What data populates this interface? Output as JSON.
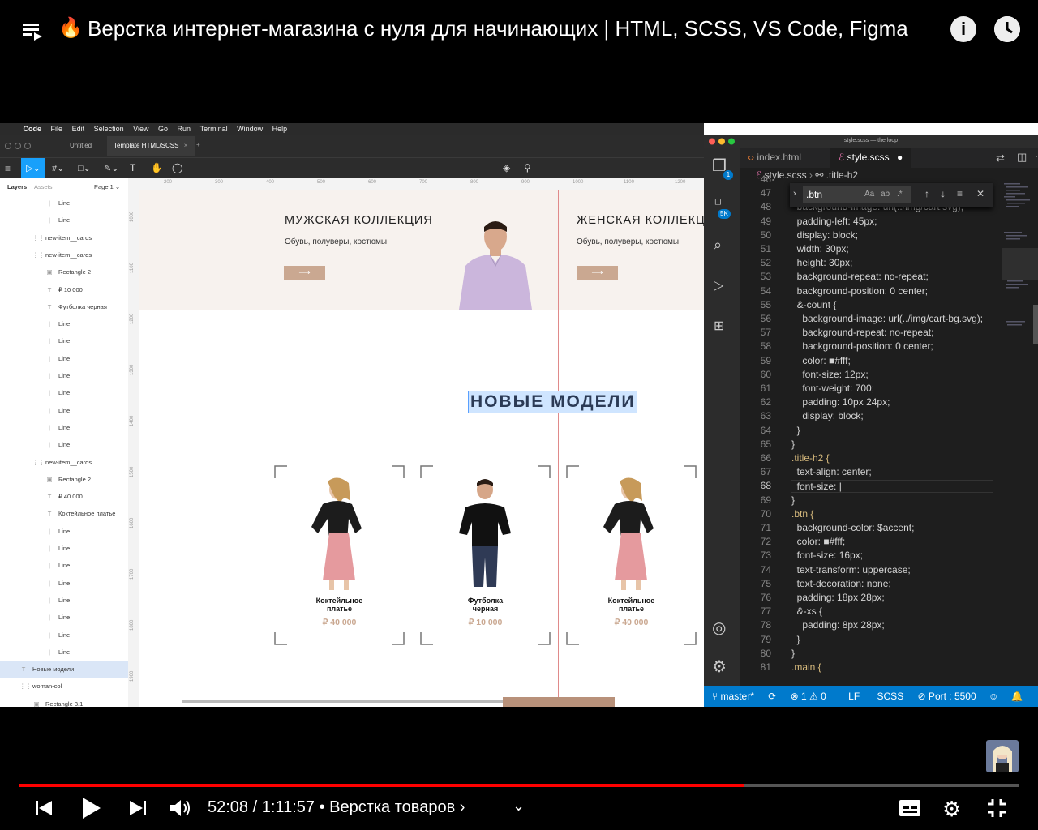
{
  "video": {
    "title": "Верстка интернет-магазина с нуля для начинающих | HTML, SCSS, VS Code, Figma",
    "time_current": "52:08",
    "time_total": "1:11:57",
    "chapter": "• Верстка товаров ›",
    "progress": 0.725
  },
  "mac_menu": [
    "Code",
    "File",
    "Edit",
    "Selection",
    "View",
    "Go",
    "Run",
    "Terminal",
    "Window",
    "Help"
  ],
  "figma": {
    "tabs": [
      "Untitled",
      "Template HTML/SCSS"
    ],
    "panel_tabs": [
      "Layers",
      "Assets"
    ],
    "page": "Page 1 ⌄",
    "layers": [
      {
        "icon": "|",
        "label": "Line",
        "indent": 3
      },
      {
        "icon": "|",
        "label": "Line",
        "indent": 3
      },
      {
        "icon": "⋮⋮",
        "label": "new-item__cards",
        "indent": 2
      },
      {
        "icon": "⋮⋮",
        "label": "new-item__cards",
        "indent": 2
      },
      {
        "icon": "▣",
        "label": "Rectangle 2",
        "indent": 3
      },
      {
        "icon": "T",
        "label": "₽ 10 000",
        "indent": 3
      },
      {
        "icon": "T",
        "label": "Футболка черная",
        "indent": 3
      },
      {
        "icon": "|",
        "label": "Line",
        "indent": 3
      },
      {
        "icon": "|",
        "label": "Line",
        "indent": 3
      },
      {
        "icon": "|",
        "label": "Line",
        "indent": 3
      },
      {
        "icon": "|",
        "label": "Line",
        "indent": 3
      },
      {
        "icon": "|",
        "label": "Line",
        "indent": 3
      },
      {
        "icon": "|",
        "label": "Line",
        "indent": 3
      },
      {
        "icon": "|",
        "label": "Line",
        "indent": 3
      },
      {
        "icon": "|",
        "label": "Line",
        "indent": 3
      },
      {
        "icon": "⋮⋮",
        "label": "new-item__cards",
        "indent": 2
      },
      {
        "icon": "▣",
        "label": "Rectangle 2",
        "indent": 3
      },
      {
        "icon": "T",
        "label": "₽ 40 000",
        "indent": 3
      },
      {
        "icon": "T",
        "label": "Коктейльное платье",
        "indent": 3
      },
      {
        "icon": "|",
        "label": "Line",
        "indent": 3
      },
      {
        "icon": "|",
        "label": "Line",
        "indent": 3
      },
      {
        "icon": "|",
        "label": "Line",
        "indent": 3
      },
      {
        "icon": "|",
        "label": "Line",
        "indent": 3
      },
      {
        "icon": "|",
        "label": "Line",
        "indent": 3
      },
      {
        "icon": "|",
        "label": "Line",
        "indent": 3
      },
      {
        "icon": "|",
        "label": "Line",
        "indent": 3
      },
      {
        "icon": "|",
        "label": "Line",
        "indent": 3
      },
      {
        "icon": "T",
        "label": "Новые модели",
        "indent": 1,
        "selected": true
      },
      {
        "icon": "⋮⋮",
        "label": "woman-col",
        "indent": 1
      },
      {
        "icon": "▣",
        "label": "Rectangle 3.1",
        "indent": 2
      }
    ],
    "ruler_top": [
      "200",
      "300",
      "400",
      "500",
      "600",
      "700",
      "800",
      "900",
      "1000",
      "1100",
      "1200"
    ],
    "ruler_left": [
      "1000",
      "1100",
      "1200",
      "1300",
      "1400",
      "1500",
      "1600",
      "1700",
      "1800",
      "1900"
    ],
    "men": {
      "title": "МУЖСКАЯ КОЛЛЕКЦИЯ",
      "subtitle": "Обувь, полуверы, костюмы",
      "btn": "⟶"
    },
    "women": {
      "title": "ЖЕНСКАЯ КОЛЛЕКЦ",
      "subtitle": "Обувь, полуверы, костюмы",
      "btn": "⟶"
    },
    "heading": "НОВЫЕ МОДЕЛИ",
    "cards": [
      {
        "name": "Коктейльное\nплатье",
        "price": "₽ 40 000"
      },
      {
        "name": "Футболка\nчерная",
        "price": "₽ 10 000"
      },
      {
        "name": "Коктейльное\nплатье",
        "price": "₽ 40 000"
      }
    ],
    "accent": "#caa891"
  },
  "vscode": {
    "window_title": "style.scss — the loop",
    "tabs": [
      {
        "label": "index.html"
      },
      {
        "label": "style.scss"
      }
    ],
    "breadcrumb": [
      "style.scss",
      ".title-h2"
    ],
    "find_value": ".btn",
    "badges": {
      "explorer": "1",
      "scm": "5K"
    },
    "lines": [
      {
        "n": "46",
        "t": ""
      },
      {
        "n": "47",
        "t": ""
      },
      {
        "n": "48",
        "t": "  background-image: url(../img/cart.svg);"
      },
      {
        "n": "49",
        "t": "  padding-left: 45px;"
      },
      {
        "n": "50",
        "t": "  display: block;"
      },
      {
        "n": "51",
        "t": "  width: 30px;"
      },
      {
        "n": "52",
        "t": "  height: 30px;"
      },
      {
        "n": "53",
        "t": "  background-repeat: no-repeat;"
      },
      {
        "n": "54",
        "t": "  background-position: 0 center;"
      },
      {
        "n": "55",
        "t": "  &-count {"
      },
      {
        "n": "56",
        "t": "    background-image: url(../img/cart-bg.svg);"
      },
      {
        "n": "57",
        "t": "    background-repeat: no-repeat;"
      },
      {
        "n": "58",
        "t": "    background-position: 0 center;"
      },
      {
        "n": "59",
        "t": "    color: ■#fff;"
      },
      {
        "n": "60",
        "t": "    font-size: 12px;"
      },
      {
        "n": "61",
        "t": "    font-weight: 700;"
      },
      {
        "n": "62",
        "t": "    padding: 10px 24px;"
      },
      {
        "n": "63",
        "t": "    display: block;"
      },
      {
        "n": "64",
        "t": "  }"
      },
      {
        "n": "65",
        "t": "}"
      },
      {
        "n": "66",
        "t": ".title-h2 {"
      },
      {
        "n": "67",
        "t": "  text-align: center;"
      },
      {
        "n": "68",
        "t": "  font-size: |"
      },
      {
        "n": "69",
        "t": "}"
      },
      {
        "n": "70",
        "t": ".btn {"
      },
      {
        "n": "71",
        "t": "  background-color: $accent;"
      },
      {
        "n": "72",
        "t": "  color: ■#fff;"
      },
      {
        "n": "73",
        "t": "  font-size: 16px;"
      },
      {
        "n": "74",
        "t": "  text-transform: uppercase;"
      },
      {
        "n": "75",
        "t": "  text-decoration: none;"
      },
      {
        "n": "76",
        "t": "  padding: 18px 28px;"
      },
      {
        "n": "77",
        "t": "  &-xs {"
      },
      {
        "n": "78",
        "t": "    padding: 8px 28px;"
      },
      {
        "n": "79",
        "t": "  }"
      },
      {
        "n": "80",
        "t": "}"
      },
      {
        "n": "81",
        "t": ".main {"
      }
    ],
    "status": {
      "branch": "master*",
      "errors": "⊗ 1",
      "warnings": "⚠ 0",
      "eol": "LF",
      "lang": "SCSS",
      "port": "⊘ Port : 5500"
    }
  }
}
